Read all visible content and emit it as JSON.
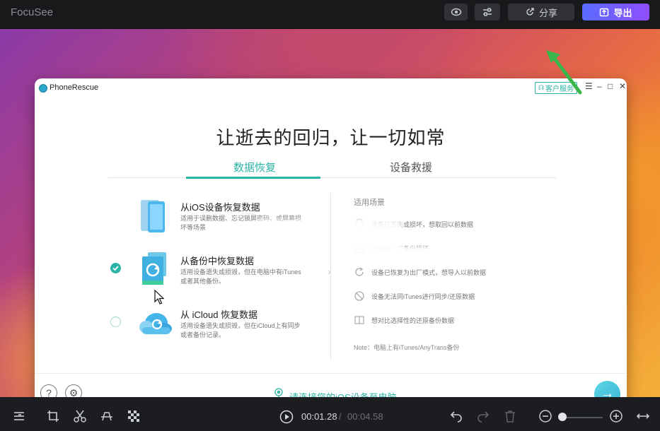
{
  "app": {
    "title": "FocuSee",
    "share_label": "分享",
    "export_label": "导出"
  },
  "phonerescue": {
    "app_name": "PhoneRescue",
    "service_label": "客户服务",
    "headline": "让逝去的回归，让一切如常",
    "tabs": [
      {
        "label": "数据恢复",
        "active": true
      },
      {
        "label": "设备救援",
        "active": false
      }
    ],
    "options": [
      {
        "title": "从iOS设备恢复数据",
        "desc": "适用于误删数据、忘记锁屏密码、或屏幕损坏等场景",
        "selected": false
      },
      {
        "title": "从备份中恢复数据",
        "desc": "适用设备遗失或损毁，但在电脑中有iTunes或者其他备份。",
        "selected": true
      },
      {
        "title": "从 iCloud 恢复数据",
        "desc": "适用设备遗失或损毁，但在iCloud上有同步或者备份记录。",
        "selected": false
      }
    ],
    "scenes_heading": "适用场景",
    "scenes": [
      "设备已丢失或损坏，想取回以前数据",
      "忘记密码或备份损坏",
      "设备已恢复为出厂模式，想导入以前数据",
      "设备无法同iTunes进行同步/还原数据",
      "想对比选择性的还原备份数据"
    ],
    "note": "Note：电脑上有iTunes/AnyTrans备份",
    "connect_prompt": "请连接您的iOS设备至电脑",
    "colors": {
      "accent": "#2bb3a6"
    }
  },
  "player": {
    "current_time": "00:01.28",
    "separator": "/",
    "total_time": "00:04.58",
    "zoom_level": 0.0
  }
}
